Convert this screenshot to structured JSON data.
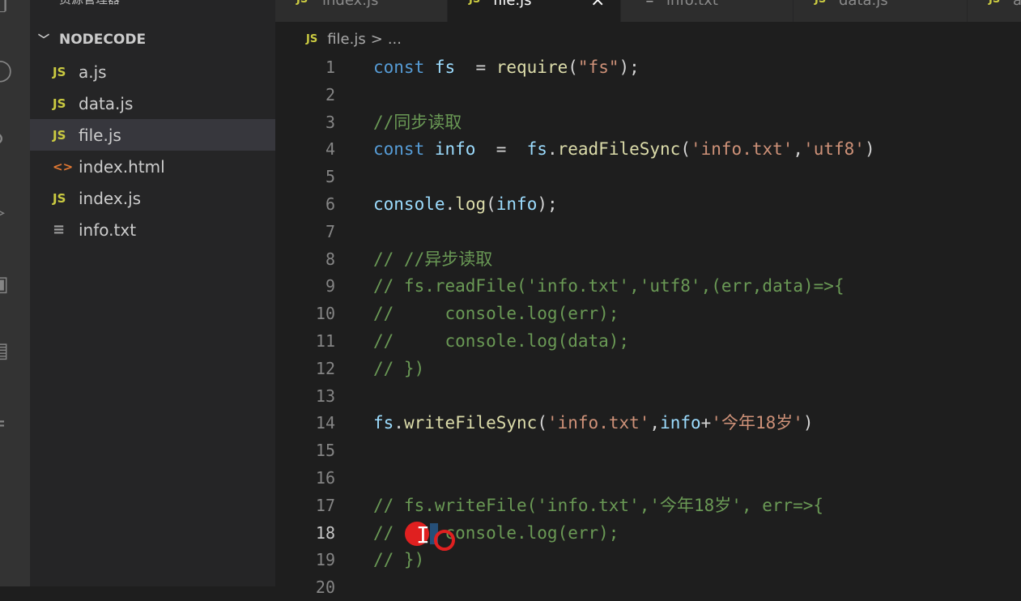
{
  "activity_bar": {
    "icons": [
      "explorer-icon",
      "search-icon",
      "source-control-icon",
      "run-debug-icon",
      "extensions-icon",
      "remote-icon",
      "accounts-icon"
    ]
  },
  "sidebar": {
    "title": "资源管理器",
    "folder": "NODECODE",
    "files": [
      {
        "name": "a.js",
        "type": "js",
        "icon": "JS"
      },
      {
        "name": "data.js",
        "type": "js",
        "icon": "JS"
      },
      {
        "name": "file.js",
        "type": "js",
        "icon": "JS",
        "active": true
      },
      {
        "name": "index.html",
        "type": "html",
        "icon": "<>"
      },
      {
        "name": "index.js",
        "type": "js",
        "icon": "JS"
      },
      {
        "name": "info.txt",
        "type": "txt",
        "icon": "≡"
      }
    ]
  },
  "tabs": [
    {
      "label": "index.js",
      "icon": "JS"
    },
    {
      "label": "file.js",
      "icon": "JS",
      "active": true,
      "close": "×"
    },
    {
      "label": "info.txt",
      "icon": "≡"
    },
    {
      "label": "data.js",
      "icon": "JS"
    },
    {
      "label": "a",
      "icon": "JS"
    }
  ],
  "breadcrumb": {
    "icon": "JS",
    "file": "file.js",
    "separator": ">",
    "more": "..."
  },
  "editor": {
    "current_line": 18,
    "lines": [
      {
        "n": "1",
        "tokens": [
          [
            "kw",
            "const "
          ],
          [
            "var",
            "fs"
          ],
          [
            "",
            "  = "
          ],
          [
            "fn",
            "require"
          ],
          [
            "",
            "("
          ],
          [
            "str",
            "\"fs\""
          ],
          [
            "",
            ");"
          ]
        ]
      },
      {
        "n": "2",
        "tokens": []
      },
      {
        "n": "3",
        "tokens": [
          [
            "cmt",
            "//同步读取"
          ]
        ]
      },
      {
        "n": "4",
        "tokens": [
          [
            "kw",
            "const "
          ],
          [
            "var",
            "info"
          ],
          [
            "",
            "  =  "
          ],
          [
            "var",
            "fs"
          ],
          [
            "",
            "."
          ],
          [
            "fn",
            "readFileSync"
          ],
          [
            "",
            "("
          ],
          [
            "str",
            "'info.txt'"
          ],
          [
            "",
            ","
          ],
          [
            "str",
            "'utf8'"
          ],
          [
            "",
            ")"
          ]
        ]
      },
      {
        "n": "5",
        "tokens": []
      },
      {
        "n": "6",
        "tokens": [
          [
            "var",
            "console"
          ],
          [
            "",
            "."
          ],
          [
            "fn",
            "log"
          ],
          [
            "",
            "("
          ],
          [
            "var",
            "info"
          ],
          [
            "",
            ");"
          ]
        ]
      },
      {
        "n": "7",
        "tokens": []
      },
      {
        "n": "8",
        "tokens": [
          [
            "cmt",
            "// //异步读取"
          ]
        ]
      },
      {
        "n": "9",
        "tokens": [
          [
            "cmt",
            "// fs.readFile('info.txt','utf8',(err,data)=>{"
          ]
        ]
      },
      {
        "n": "10",
        "tokens": [
          [
            "cmt",
            "//     console.log(err);"
          ]
        ]
      },
      {
        "n": "11",
        "tokens": [
          [
            "cmt",
            "//     console.log(data);"
          ]
        ]
      },
      {
        "n": "12",
        "tokens": [
          [
            "cmt",
            "// })"
          ]
        ]
      },
      {
        "n": "13",
        "tokens": []
      },
      {
        "n": "14",
        "tokens": [
          [
            "var",
            "fs"
          ],
          [
            "",
            "."
          ],
          [
            "fn",
            "writeFileSync"
          ],
          [
            "",
            "("
          ],
          [
            "str",
            "'info.txt'"
          ],
          [
            "",
            ","
          ],
          [
            "var",
            "info"
          ],
          [
            "",
            "+"
          ],
          [
            "str",
            "'今年18岁'"
          ],
          [
            "",
            ")"
          ]
        ]
      },
      {
        "n": "15",
        "tokens": []
      },
      {
        "n": "16",
        "tokens": []
      },
      {
        "n": "17",
        "tokens": [
          [
            "cmt",
            "// fs.writeFile('info.txt','今年18岁', err=>{"
          ]
        ]
      },
      {
        "n": "18",
        "tokens": [
          [
            "cmt",
            "//     console.log(err);"
          ]
        ]
      },
      {
        "n": "19",
        "tokens": [
          [
            "cmt",
            "// })"
          ]
        ]
      },
      {
        "n": "20",
        "tokens": []
      }
    ]
  }
}
